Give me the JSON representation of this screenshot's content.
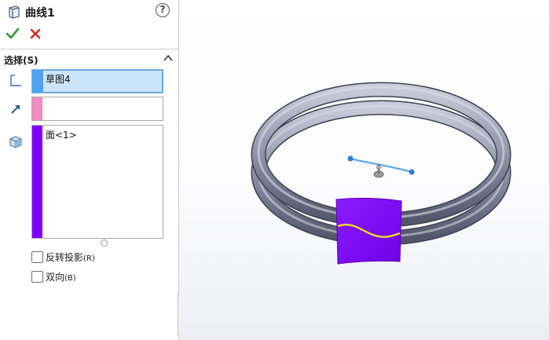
{
  "panel": {
    "title": "曲线1",
    "help_label": "?",
    "group": {
      "title": "选择(S)",
      "boxes": [
        {
          "value": "草图4",
          "swatch_color": "#4da3f0",
          "icon": "sketch-icon"
        },
        {
          "value": "",
          "swatch_color": "#f48cc0",
          "icon": "direction-arrow-icon"
        },
        {
          "value": "面<1>",
          "swatch_color": "#8000ff",
          "icon": "face-cube-icon"
        }
      ]
    },
    "options": [
      {
        "label": "反转投影",
        "accel": "(R)",
        "checked": false
      },
      {
        "label": "双向",
        "accel": "(B)",
        "checked": false
      }
    ]
  },
  "colors": {
    "ok": "#2e9a2e",
    "cancel": "#d9231e",
    "face": "#8000ff",
    "curve": "#f2d62e",
    "sketch": "#4da3f0",
    "torus": "#8e92a8"
  }
}
